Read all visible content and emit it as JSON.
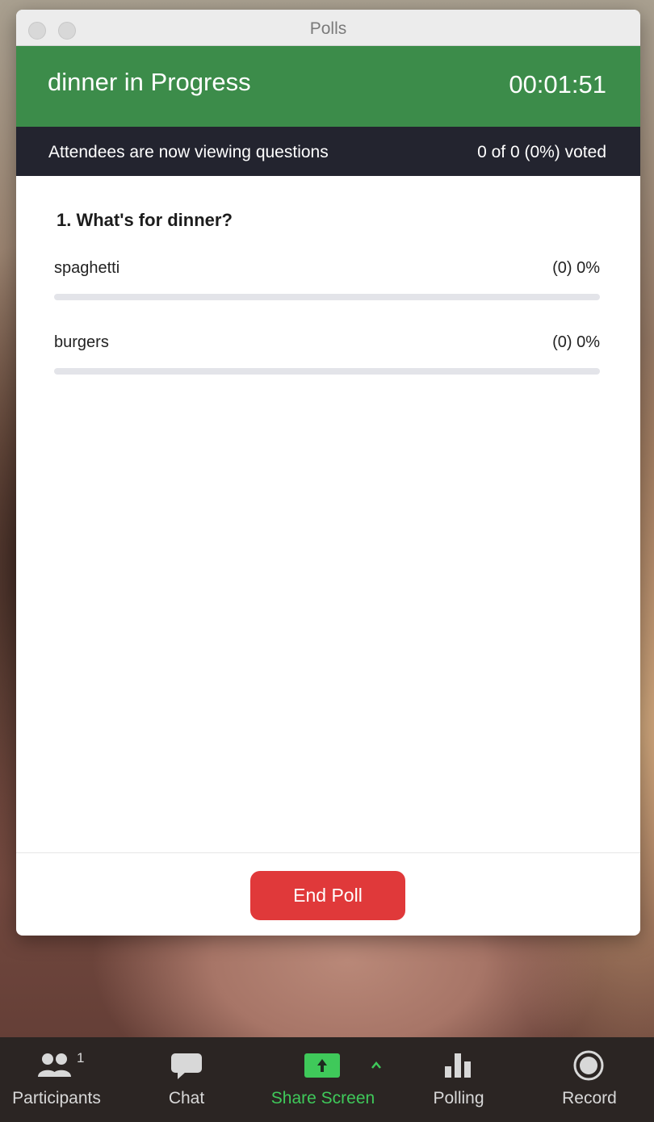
{
  "window": {
    "title": "Polls"
  },
  "poll": {
    "name": "dinner in Progress",
    "timer": "00:01:51",
    "status": "Attendees are now viewing questions",
    "voted": "0 of 0 (0%) voted",
    "question": "1. What's for dinner?",
    "options": [
      {
        "label": "spaghetti",
        "result": "(0) 0%",
        "fraction": 0
      },
      {
        "label": "burgers",
        "result": "(0) 0%",
        "fraction": 0
      }
    ],
    "end_button": "End Poll"
  },
  "colors": {
    "header_green": "#3c8c4a",
    "status_dark": "#23242f",
    "end_red": "#e0393a",
    "share_green": "#3fc95a"
  },
  "toolbar": {
    "participants": {
      "label": "Participants",
      "count": "1",
      "icon": "participants-icon"
    },
    "chat": {
      "label": "Chat",
      "icon": "chat-icon"
    },
    "share": {
      "label": "Share Screen",
      "icon": "share-screen-icon"
    },
    "polling": {
      "label": "Polling",
      "icon": "polling-icon"
    },
    "record": {
      "label": "Record",
      "icon": "record-icon"
    }
  }
}
